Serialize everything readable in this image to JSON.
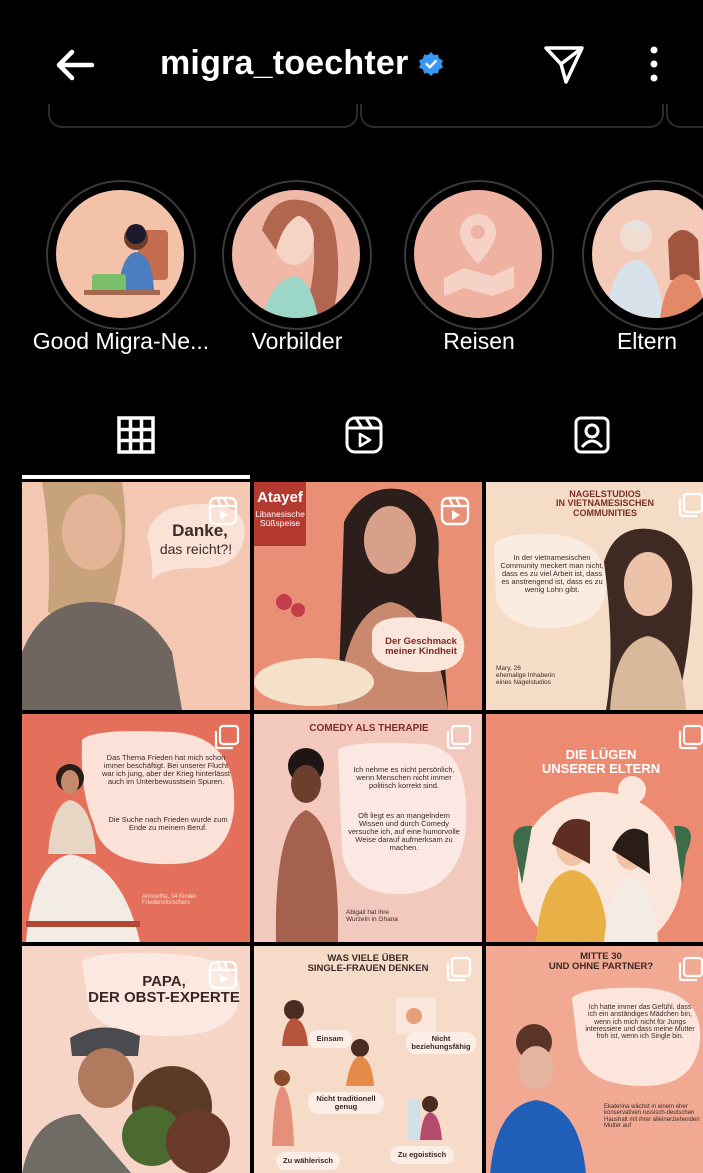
{
  "header": {
    "username": "migra_toechter",
    "back_icon": "arrow-left-icon",
    "verified_icon": "verified-badge-icon",
    "send_icon": "paper-plane-icon",
    "more_icon": "more-vertical-icon"
  },
  "highlights": [
    {
      "label": "Good Migra-Ne..."
    },
    {
      "label": "Vorbilder"
    },
    {
      "label": "Reisen"
    },
    {
      "label": "Eltern"
    }
  ],
  "tabs": [
    "grid-icon",
    "reels-icon",
    "tagged-icon"
  ],
  "posts": {
    "p1": {
      "line1": "Danke,",
      "line2": "das reicht?!"
    },
    "p2": {
      "title": "Atayef",
      "subtitle": "Libanesische\nSüßspeise",
      "bubble": "Der Geschmack\nmeiner Kindheit"
    },
    "p3": {
      "title": "NAGELSTUDIOS\nIN VIETNAMESISCHEN\nCOMMUNITIES",
      "quote": "In der vietnamesischen Community meckert man nicht, dass es zu viel Arbeit ist, dass es anstrengend ist, dass es zu wenig Lohn gibt.",
      "caption": "Mary, 26\nehemalige Inhaberin\neines Nagelstudios"
    },
    "p4": {
      "quote1": "Das Thema Frieden hat mich schon immer beschäftigt. Bei unserer Flucht war ich jung, aber der Krieg hinterlässt auch im Unterbewusstsein Spuren.",
      "quote2": "Die Suche nach Frieden wurde zum Ende zu meinem Beruf.",
      "caption": "Annoufita, 34 Kinder\nFriedensforschers"
    },
    "p5": {
      "title": "COMEDY ALS THERAPIE",
      "quote1": "Ich nehme es nicht persönlich, wenn Menschen nicht immer politisch korrekt sind.",
      "quote2": "Oft liegt es an mangelndem Wissen und durch Comedy versuche ich, auf eine humorvolle Weise darauf aufmerksam zu machen.",
      "caption": "Abigail hat ihre\nWurzeln in Ghana"
    },
    "p6": {
      "title": "DIE LÜGEN\nUNSERER ELTERN"
    },
    "p7": {
      "title": "PAPA,\nDER OBST-EXPERTE"
    },
    "p8": {
      "title": "WAS VIELE ÜBER\nSINGLE-FRAUEN DENKEN",
      "labels": [
        "Einsam",
        "Nicht\nbeziehungsfähig",
        "Nicht traditionell\ngenug",
        "Zu wählerisch",
        "Zu egoistisch"
      ]
    },
    "p9": {
      "title": "MITTE 30\nUND OHNE PARTNER?",
      "quote": "Ich hatte immer das Gefühl, dass ich ein anständiges Mädchen bin, wenn ich mich nicht für Jungs interessiere und dass meine Mutter froh ist, wenn ich Single bin.",
      "caption": "Ekaterina wächst in einem eher konservativen russisch-deutschen Haushalt mit ihrer alleinerziehenden Mutter auf"
    }
  },
  "colors": {
    "background": "#000000",
    "accent_verified": "#3897f0",
    "peach": "#f4c6b3",
    "coral": "#e4755e"
  }
}
